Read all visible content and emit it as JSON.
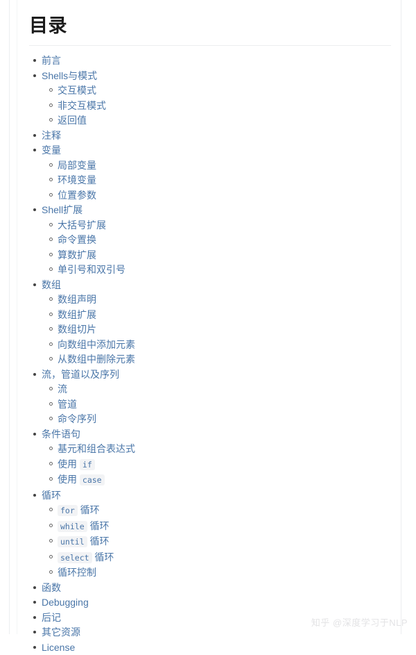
{
  "page": {
    "title": "目录",
    "watermark": "知乎 @深度学习于NLP",
    "link_color": "#4a76a8",
    "title_color": "#1a1a1a",
    "rule_color": "#eceeef",
    "code_background": "#f2f3f5",
    "background": "#ffffff"
  },
  "toc": [
    {
      "label": "前言",
      "children": []
    },
    {
      "label": "Shells与模式",
      "children": [
        {
          "label": "交互模式"
        },
        {
          "label": "非交互模式"
        },
        {
          "label": "返回值"
        }
      ]
    },
    {
      "label": "注释",
      "children": []
    },
    {
      "label": "变量",
      "children": [
        {
          "label": "局部变量"
        },
        {
          "label": "环境变量"
        },
        {
          "label": "位置参数"
        }
      ]
    },
    {
      "label": "Shell扩展",
      "children": [
        {
          "label": "大括号扩展"
        },
        {
          "label": "命令置换"
        },
        {
          "label": "算数扩展"
        },
        {
          "label": "单引号和双引号"
        }
      ]
    },
    {
      "label": "数组",
      "children": [
        {
          "label": "数组声明"
        },
        {
          "label": "数组扩展"
        },
        {
          "label": "数组切片"
        },
        {
          "label": "向数组中添加元素"
        },
        {
          "label": "从数组中删除元素"
        }
      ]
    },
    {
      "label": "流，管道以及序列",
      "children": [
        {
          "label": "流"
        },
        {
          "label": "管道"
        },
        {
          "label": "命令序列"
        }
      ]
    },
    {
      "label": "条件语句",
      "children": [
        {
          "label": "基元和组合表达式"
        },
        {
          "parts": [
            {
              "type": "text",
              "text": "使用 "
            },
            {
              "type": "code",
              "text": "if"
            }
          ]
        },
        {
          "parts": [
            {
              "type": "text",
              "text": "使用 "
            },
            {
              "type": "code",
              "text": "case"
            }
          ]
        }
      ]
    },
    {
      "label": "循环",
      "children": [
        {
          "parts": [
            {
              "type": "code",
              "text": "for"
            },
            {
              "type": "text",
              "text": " 循环"
            }
          ]
        },
        {
          "parts": [
            {
              "type": "code",
              "text": "while"
            },
            {
              "type": "text",
              "text": " 循环"
            }
          ]
        },
        {
          "parts": [
            {
              "type": "code",
              "text": "until"
            },
            {
              "type": "text",
              "text": " 循环"
            }
          ]
        },
        {
          "parts": [
            {
              "type": "code",
              "text": "select"
            },
            {
              "type": "text",
              "text": " 循环"
            }
          ]
        },
        {
          "label": "循环控制"
        }
      ]
    },
    {
      "label": "函数",
      "children": []
    },
    {
      "label": "Debugging",
      "children": []
    },
    {
      "label": "后记",
      "children": []
    },
    {
      "label": "其它资源",
      "children": []
    },
    {
      "label": "License",
      "children": []
    }
  ]
}
